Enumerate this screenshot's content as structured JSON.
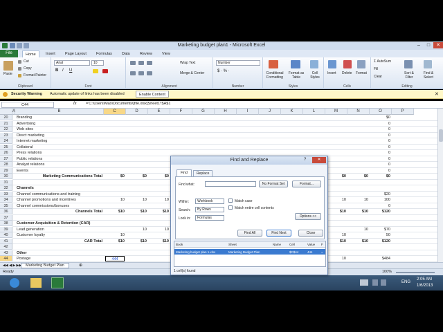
{
  "window": {
    "title": "Marketing budget plan1 - Microsoft Excel"
  },
  "tabs": [
    "File",
    "Home",
    "Insert",
    "Page Layout",
    "Formulas",
    "Data",
    "Review",
    "View"
  ],
  "ribbon": {
    "clipboard": {
      "label": "Clipboard",
      "paste": "Paste",
      "cut": "Cut",
      "copy": "Copy",
      "format_painter": "Format Painter"
    },
    "font": {
      "label": "Font",
      "name": "Arial",
      "size": "10"
    },
    "alignment": {
      "label": "Alignment",
      "wrap": "Wrap Text",
      "merge": "Merge & Center"
    },
    "number": {
      "label": "Number",
      "format": "Number",
      "symbols": "$ · % ·"
    },
    "styles": {
      "label": "Styles",
      "conditional": "Conditional Formatting",
      "format_table": "Format as Table",
      "cell_styles": "Cell Styles"
    },
    "cells": {
      "label": "Cells",
      "insert": "Insert",
      "delete": "Delete",
      "format": "Format"
    },
    "editing": {
      "label": "Editing",
      "autosum": "AutoSum",
      "fill": "Fill",
      "clear": "Clear",
      "sort": "Sort & Filter",
      "find": "Find & Select"
    }
  },
  "security": {
    "title": "Security Warning",
    "message": "Automatic update of links has been disabled",
    "button": "Enable Content"
  },
  "formula_bar": {
    "name_box": "C44",
    "fx": "fx",
    "formula": "='C:\\Users\\Max\\Documents\\[file.xlsx]Sheet1'!$A$1"
  },
  "columns": [
    "A",
    "B",
    "C",
    "D",
    "E",
    "F",
    "G",
    "H",
    "I",
    "J",
    "K",
    "L",
    "M",
    "N",
    "O",
    "P"
  ],
  "rows": [
    {
      "n": "20",
      "b": "Branding",
      "o": "$0"
    },
    {
      "n": "21",
      "b": "Advertising",
      "o": "0"
    },
    {
      "n": "22",
      "b": "Web sites",
      "o": "0"
    },
    {
      "n": "23",
      "b": "Direct marketing",
      "o": "0"
    },
    {
      "n": "24",
      "b": "Internet marketing",
      "o": "0"
    },
    {
      "n": "25",
      "b": "Collateral",
      "o": "0"
    },
    {
      "n": "26",
      "b": "Press relations",
      "o": "0"
    },
    {
      "n": "27",
      "b": "Public relations",
      "o": "0"
    },
    {
      "n": "28",
      "b": "Analyst relations",
      "o": "0"
    },
    {
      "n": "29",
      "b": "Events",
      "o": "0"
    },
    {
      "n": "30",
      "total": "Marketing Communications Total",
      "c": "$0",
      "d": "$0",
      "e": "$0",
      "m": "$0",
      "nn": "$0",
      "o": "$0",
      "bold": true
    },
    {
      "n": "31"
    },
    {
      "n": "32",
      "b": "Channels",
      "bold": true
    },
    {
      "n": "33",
      "b": "Channel communications and training",
      "o": "$20"
    },
    {
      "n": "34",
      "b": "Channel promotions and incentives",
      "c": "10",
      "d": "10",
      "e": "10",
      "m": "10",
      "nn": "10",
      "o": "100"
    },
    {
      "n": "35",
      "b": "Channel commissions/bonuses",
      "o": "0"
    },
    {
      "n": "36",
      "total": "Channels Total",
      "c": "$10",
      "d": "$10",
      "e": "$10",
      "m": "$10",
      "nn": "$10",
      "o": "$120",
      "bold": true
    },
    {
      "n": "37"
    },
    {
      "n": "38",
      "b": "Customer Acquisition & Retention (CAR)",
      "bold": true
    },
    {
      "n": "39",
      "b": "Lead generation",
      "d": "10",
      "e": "10",
      "nn": "10",
      "o": "$70"
    },
    {
      "n": "40",
      "b": "Customer loyalty",
      "c": "10",
      "m": "10",
      "o": "50"
    },
    {
      "n": "41",
      "total": "CAR Total",
      "c": "$10",
      "d": "$10",
      "e": "$10",
      "m": "$10",
      "nn": "$10",
      "o": "$120",
      "bold": true
    },
    {
      "n": "42"
    },
    {
      "n": "43",
      "b": "Other",
      "bold": true
    },
    {
      "n": "44",
      "b": "Postage",
      "c": "444",
      "m": "10",
      "o": "$484"
    }
  ],
  "sheet_tab": "Marketing Budget Plan",
  "status": {
    "ready": "Ready",
    "zoom": "100%"
  },
  "taskbar": {
    "lang": "ENG",
    "time": "2:05 AM",
    "date": "1/6/2013"
  },
  "dialog": {
    "title": "Find and Replace",
    "help": "?",
    "close": "✕",
    "tab_find": "Find",
    "tab_replace": "Replace",
    "find_what_label": "Find what:",
    "find_what_value": "",
    "no_format": "No Format Set",
    "format_btn": "Format...",
    "within_label": "Within:",
    "within_value": "Workbook",
    "search_label": "Search:",
    "search_value": "By Rows",
    "lookin_label": "Look in:",
    "lookin_value": "Formulas",
    "match_case": "Match case",
    "match_entire": "Match entire cell contents",
    "options_btn": "Options <<",
    "find_all": "Find All",
    "find_next": "Find Next",
    "close_btn": "Close",
    "result_headers": [
      "Book",
      "Sheet",
      "Name",
      "Cell",
      "Value",
      "F"
    ],
    "result_row": [
      "Marketing budget plan 1.xlsx",
      "Marketing Budget Plan",
      "",
      "$C$44",
      "444",
      "="
    ],
    "found": "1 cell(s) found"
  }
}
